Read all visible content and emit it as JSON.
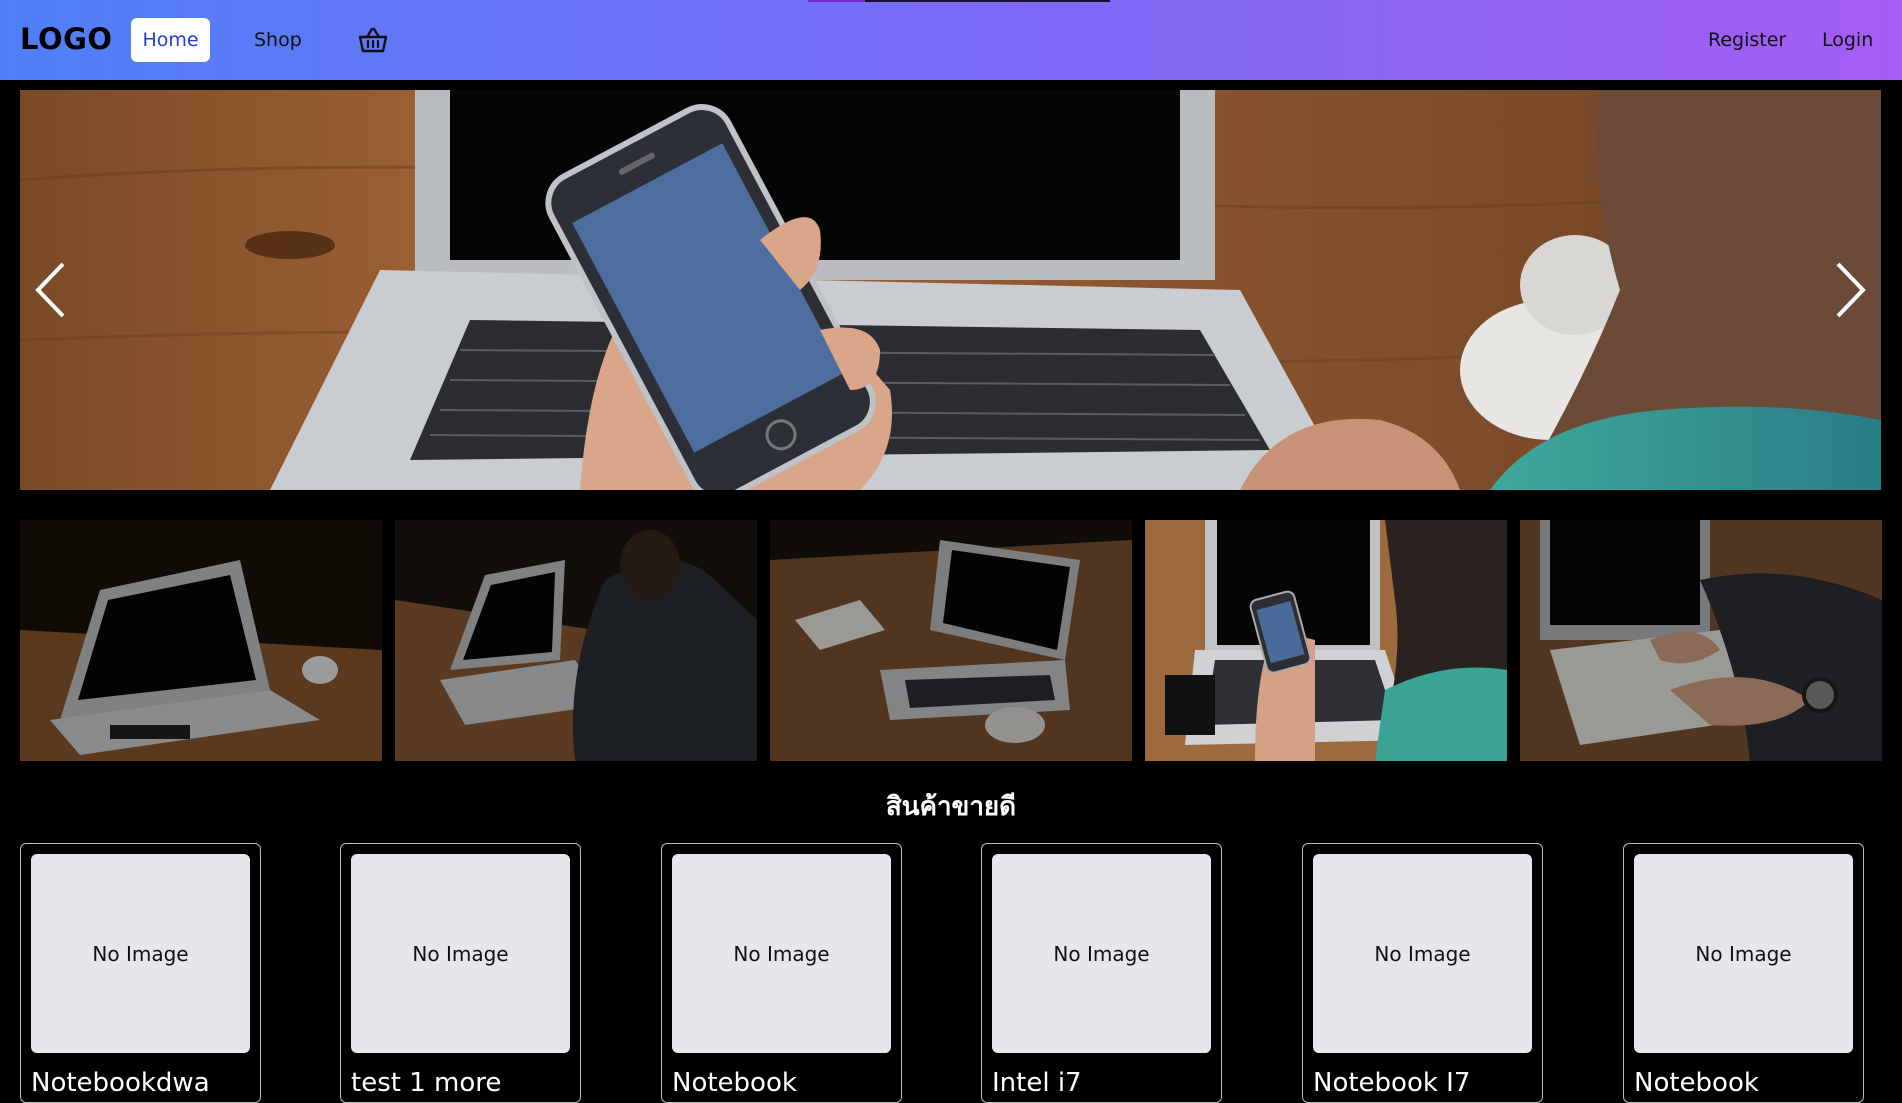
{
  "navbar": {
    "logo": "LOGO",
    "links": {
      "home": "Home",
      "shop": "Shop",
      "register": "Register",
      "login": "Login"
    },
    "cart_icon": "basket-icon",
    "page_load_progress": 0.19
  },
  "hero": {
    "image": "hand-holding-phone-over-laptop",
    "prev_icon": "chevron-left-icon",
    "next_icon": "chevron-right-icon"
  },
  "thumbnails": [
    "laptop-on-desk",
    "person-typing-on-laptop",
    "laptop-notebook-coffee",
    "hand-holding-phone-over-laptop",
    "hands-writing-in-notebook"
  ],
  "bestsellers": {
    "title": "สินค้าขายดี",
    "products": [
      {
        "image_text": "No Image",
        "name": "Notebookdwa"
      },
      {
        "image_text": "No Image",
        "name": "test 1 more"
      },
      {
        "image_text": "No Image",
        "name": "Notebook"
      },
      {
        "image_text": "No Image",
        "name": "Intel i7"
      },
      {
        "image_text": "No Image",
        "name": "Notebook I7"
      },
      {
        "image_text": "No Image",
        "name": "Notebook"
      }
    ]
  }
}
